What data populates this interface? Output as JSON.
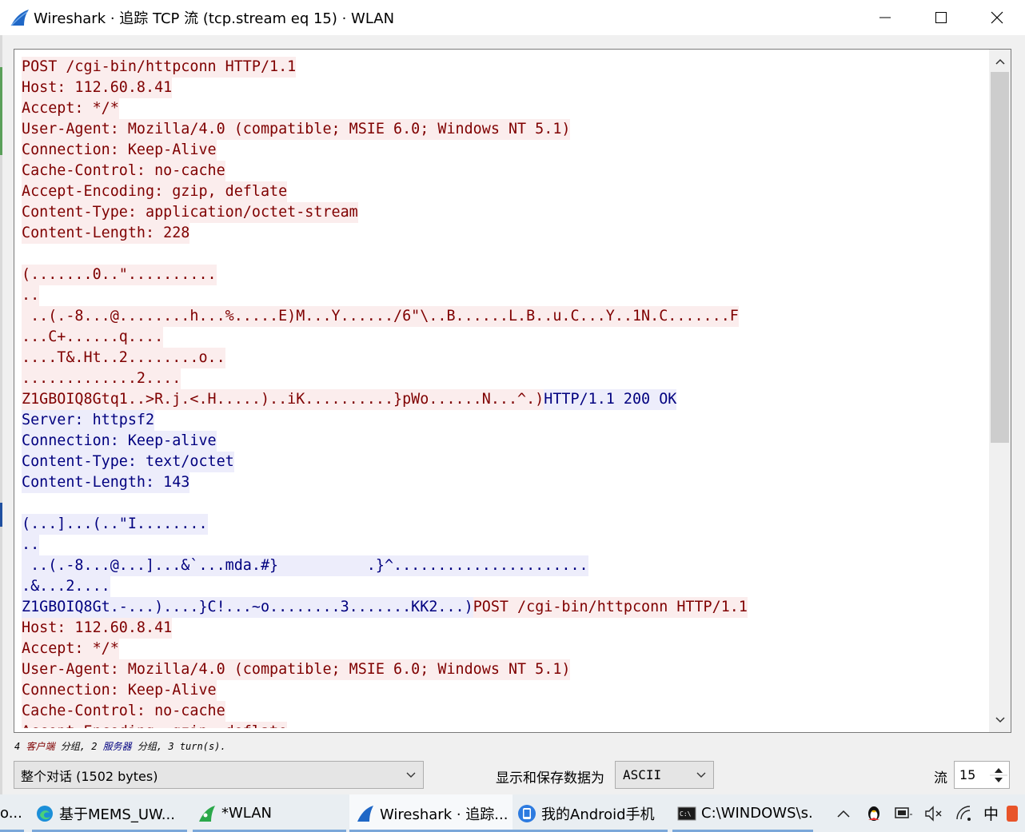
{
  "window": {
    "title": "Wireshark · 追踪 TCP 流 (tcp.stream eq 15) · WLAN"
  },
  "colors": {
    "client_bg": "#fbeded",
    "client_fg": "#7f0000",
    "server_bg": "#ededfb",
    "server_fg": "#00007f"
  },
  "stream_lines": [
    [
      {
        "t": "POST /cgi-bin/httpconn HTTP/1.1",
        "k": "c"
      }
    ],
    [
      {
        "t": "Host: 112.60.8.41",
        "k": "c"
      }
    ],
    [
      {
        "t": "Accept: */*",
        "k": "c"
      }
    ],
    [
      {
        "t": "User-Agent: Mozilla/4.0 (compatible; MSIE 6.0; Windows NT 5.1)",
        "k": "c"
      }
    ],
    [
      {
        "t": "Connection: Keep-Alive",
        "k": "c"
      }
    ],
    [
      {
        "t": "Cache-Control: no-cache",
        "k": "c"
      }
    ],
    [
      {
        "t": "Accept-Encoding: gzip, deflate",
        "k": "c"
      }
    ],
    [
      {
        "t": "Content-Type: application/octet-stream",
        "k": "c"
      }
    ],
    [
      {
        "t": "Content-Length: 228",
        "k": "c"
      }
    ],
    [],
    [
      {
        "t": "(.......0..\"..........",
        "k": "c"
      }
    ],
    [
      {
        "t": "..",
        "k": "c"
      }
    ],
    [
      {
        "t": " ..(.-8...@........h...%.....E)M...Y....../6\"\\..B......L.B..u.C...Y..1N.C.......F",
        "k": "c"
      }
    ],
    [
      {
        "t": "...C+......q....",
        "k": "c"
      }
    ],
    [
      {
        "t": "....T&.Ht..2........o..",
        "k": "c"
      }
    ],
    [
      {
        "t": ".............2....",
        "k": "c"
      }
    ],
    [
      {
        "t": "Z1GBOIQ8Gtq1..>R.j.<.H.....)..iK..........}pWo......N...^.)",
        "k": "c"
      },
      {
        "t": "HTTP/1.1 200 OK",
        "k": "s"
      }
    ],
    [
      {
        "t": "Server: httpsf2",
        "k": "s"
      }
    ],
    [
      {
        "t": "Connection: Keep-alive",
        "k": "s"
      }
    ],
    [
      {
        "t": "Content-Type: text/octet",
        "k": "s"
      }
    ],
    [
      {
        "t": "Content-Length: 143",
        "k": "s"
      }
    ],
    [],
    [
      {
        "t": "(...]...(..\"I........",
        "k": "s"
      }
    ],
    [
      {
        "t": "..",
        "k": "s"
      }
    ],
    [
      {
        "t": " ..(.-8...@...]...&`...mda.#}          .}^......................",
        "k": "s"
      }
    ],
    [
      {
        "t": ".&...2....",
        "k": "s"
      }
    ],
    [
      {
        "t": "Z1GBOIQ8Gt.-...)....}C!...~o........3.......KK2...)",
        "k": "s"
      },
      {
        "t": "POST /cgi-bin/httpconn HTTP/1.1",
        "k": "c"
      }
    ],
    [
      {
        "t": "Host: 112.60.8.41",
        "k": "c"
      }
    ],
    [
      {
        "t": "Accept: */*",
        "k": "c"
      }
    ],
    [
      {
        "t": "User-Agent: Mozilla/4.0 (compatible; MSIE 6.0; Windows NT 5.1)",
        "k": "c"
      }
    ],
    [
      {
        "t": "Connection: Keep-Alive",
        "k": "c"
      }
    ],
    [
      {
        "t": "Cache-Control: no-cache",
        "k": "c"
      }
    ],
    [
      {
        "t": "Accept-Encoding: gzip, deflate",
        "k": "c"
      }
    ]
  ],
  "summary": {
    "client_count": "4",
    "client_label": "客户端",
    "client_suffix": "分组,",
    "server_count": "2",
    "server_label": "服务器",
    "server_suffix": "分组,",
    "turns": "3 turn(s)."
  },
  "controls": {
    "conversation_value": "整个对话 (1502 bytes)",
    "show_as_label": "显示和保存数据为",
    "encoding_value": "ASCII",
    "stream_label": "流",
    "stream_value": "15"
  },
  "taskbar": {
    "items": [
      {
        "label": "o..."
      },
      {
        "label": "基于MEMS_UW..."
      },
      {
        "label": "*WLAN"
      },
      {
        "label": "Wireshark · 追踪..."
      },
      {
        "label": "我的Android手机"
      },
      {
        "label": "C:\\WINDOWS\\s..."
      }
    ],
    "tray": {
      "ime": "中"
    }
  }
}
